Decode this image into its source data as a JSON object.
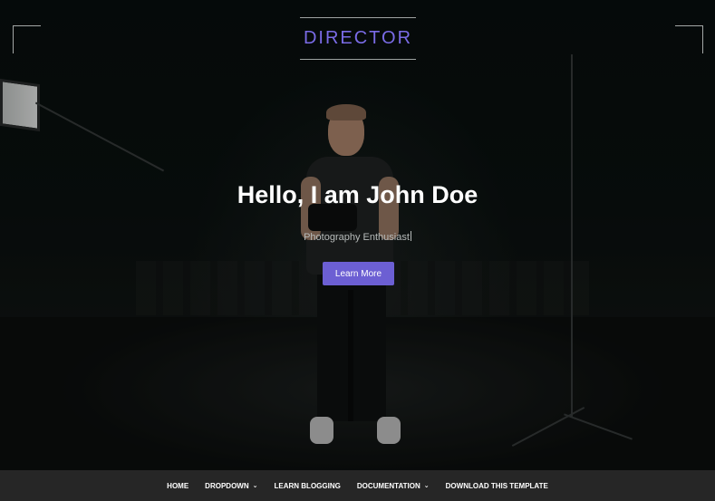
{
  "header": {
    "logo_text": "DIRECTOR"
  },
  "hero": {
    "headline": "Hello, I am John Doe",
    "subline": "Photography Enthusiast",
    "cta_label": "Learn More"
  },
  "nav": {
    "items": [
      {
        "label": "HOME",
        "has_dropdown": false
      },
      {
        "label": "DROPDOWN",
        "has_dropdown": true,
        "icon": "chevron-down-icon"
      },
      {
        "label": "LEARN BLOGGING",
        "has_dropdown": false
      },
      {
        "label": "DOCUMENTATION",
        "has_dropdown": true,
        "icon": "chevron-down-icon"
      },
      {
        "label": "DOWNLOAD THIS TEMPLATE",
        "has_dropdown": false
      }
    ]
  },
  "colors": {
    "accent": "#6c5fd3",
    "logo": "#7a6be6",
    "nav_bg": "#262626",
    "hero_bg": "#0a0f0e"
  }
}
